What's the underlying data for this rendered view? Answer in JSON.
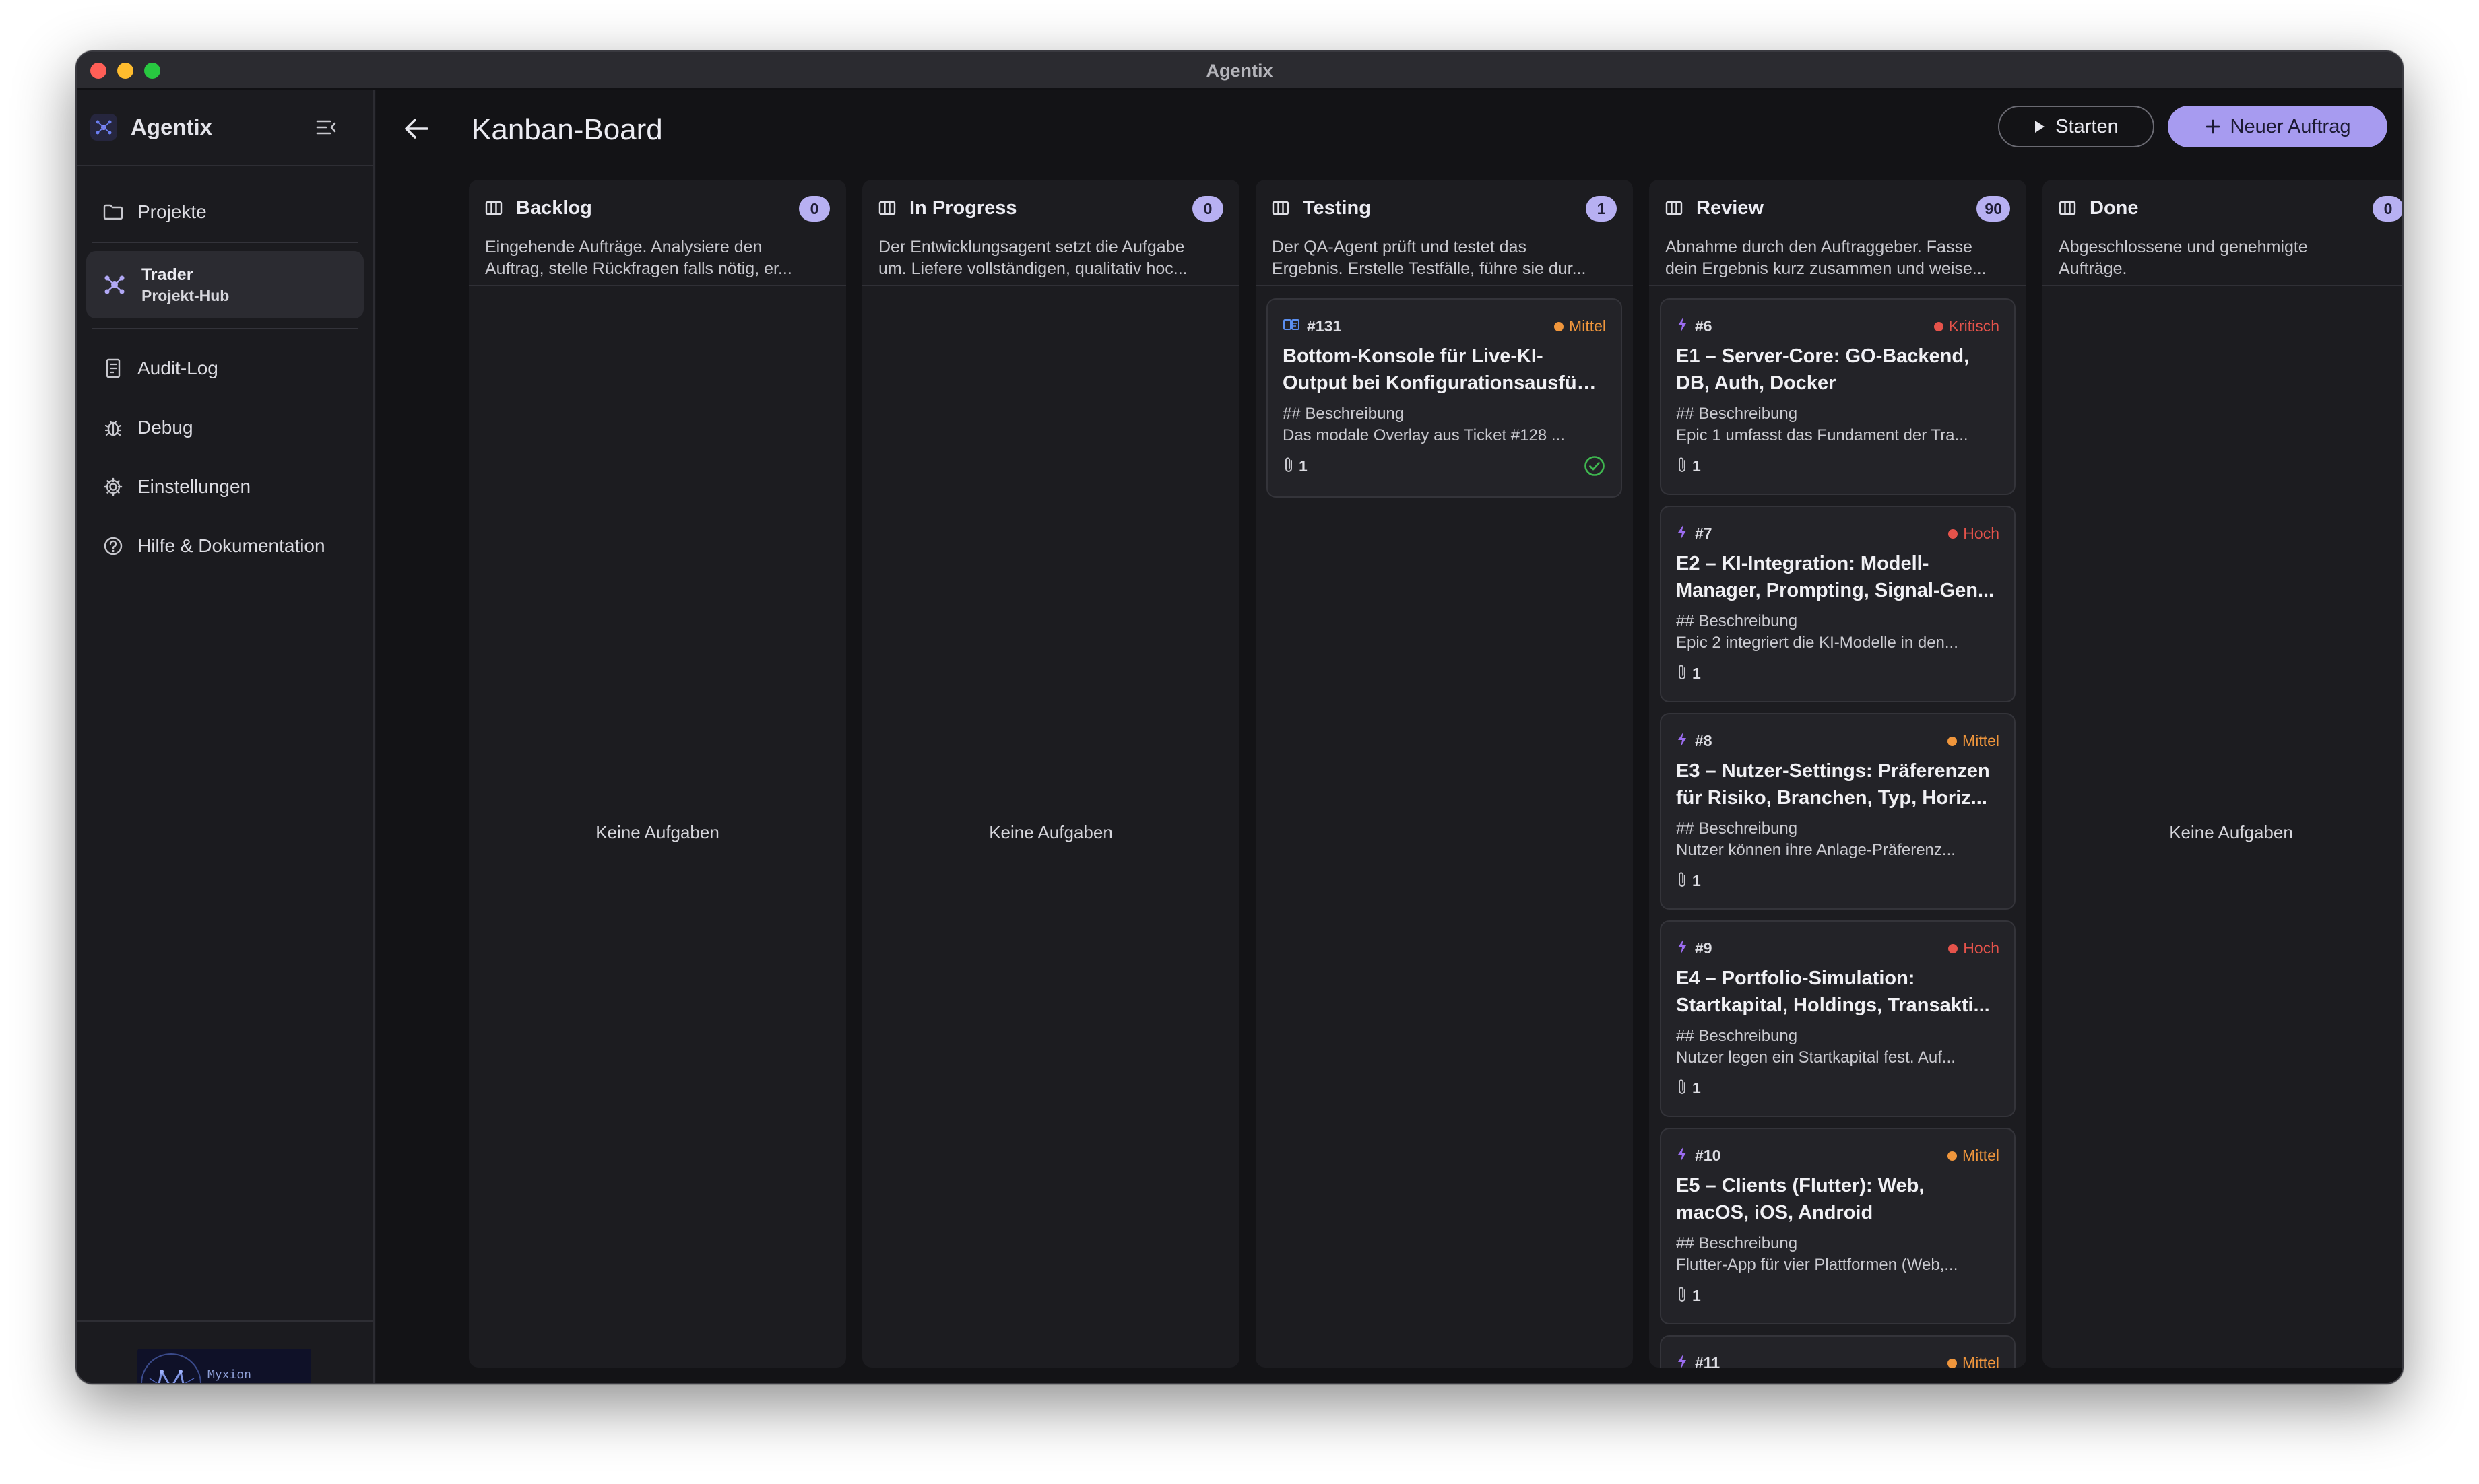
{
  "window": {
    "title": "Agentix"
  },
  "sidebar": {
    "brand": "Agentix",
    "nav_projects": "Projekte",
    "project": {
      "name": "Trader",
      "subtitle": "Projekt-Hub"
    },
    "items": [
      {
        "label": "Audit-Log",
        "icon": "document-icon"
      },
      {
        "label": "Debug",
        "icon": "bug-icon"
      },
      {
        "label": "Einstellungen",
        "icon": "gear-icon"
      },
      {
        "label": "Hilfe & Dokumentation",
        "icon": "help-icon"
      }
    ],
    "footer_logo_text": "Myxion"
  },
  "header": {
    "title": "Kanban-Board",
    "start_label": "Starten",
    "new_label": "Neuer Auftrag"
  },
  "empty_label": "Keine Aufgaben",
  "colors": {
    "accent": "#a79bf0",
    "mittel": "#f0963c",
    "hoch": "#e5534b",
    "kritisch": "#e5534b",
    "success": "#3fb950"
  },
  "columns": [
    {
      "title": "Backlog",
      "count": "0",
      "desc": [
        "Eingehende Aufträge. Analysiere den",
        "Auftrag, stelle Rückfragen falls nötig, er..."
      ]
    },
    {
      "title": "In Progress",
      "count": "0",
      "desc": [
        "Der Entwicklungsagent setzt die Aufgabe",
        "um. Liefere vollständigen, qualitativ hoc..."
      ]
    },
    {
      "title": "Testing",
      "count": "1",
      "desc": [
        "Der QA-Agent prüft und testet das",
        "Ergebnis. Erstelle Testfälle, führe sie dur..."
      ],
      "cards": [
        {
          "id": "#131",
          "priority": "Mittel",
          "title": [
            "Bottom-Konsole für Live-KI-",
            "Output bei Konfigurationsausführ..."
          ],
          "desc": [
            "## Beschreibung",
            "Das modale Overlay aus Ticket #128 ..."
          ],
          "attachments": "1"
        }
      ]
    },
    {
      "title": "Review",
      "count": "90",
      "desc": [
        "Abnahme durch den Auftraggeber. Fasse",
        "dein Ergebnis kurz zusammen und weise..."
      ],
      "cards": [
        {
          "id": "#6",
          "priority": "Kritisch",
          "title": [
            "E1 – Server-Core: GO-Backend,",
            "DB, Auth, Docker"
          ],
          "desc": [
            "## Beschreibung",
            "Epic 1 umfasst das Fundament der Tra..."
          ],
          "attachments": "1"
        },
        {
          "id": "#7",
          "priority": "Hoch",
          "title": [
            "E2 – KI-Integration: Modell-",
            "Manager, Prompting, Signal-Gen..."
          ],
          "desc": [
            "## Beschreibung",
            "Epic 2 integriert die KI-Modelle in den..."
          ],
          "attachments": "1"
        },
        {
          "id": "#8",
          "priority": "Mittel",
          "title": [
            "E3 – Nutzer-Settings: Präferenzen",
            "für Risiko, Branchen, Typ, Horiz..."
          ],
          "desc": [
            "## Beschreibung",
            "Nutzer können ihre Anlage-Präferenz..."
          ],
          "attachments": "1"
        },
        {
          "id": "#9",
          "priority": "Hoch",
          "title": [
            "E4 – Portfolio-Simulation:",
            "Startkapital, Holdings, Transakti..."
          ],
          "desc": [
            "## Beschreibung",
            "Nutzer legen ein Startkapital fest. Auf..."
          ],
          "attachments": "1"
        },
        {
          "id": "#10",
          "priority": "Mittel",
          "title": [
            "E5 – Clients (Flutter): Web,",
            "macOS, iOS, Android"
          ],
          "desc": [
            "## Beschreibung",
            "Flutter-App für vier Plattformen (Web,..."
          ],
          "attachments": "1"
        },
        {
          "id": "#11",
          "priority": "Mittel"
        }
      ]
    },
    {
      "title": "Done",
      "count": "0",
      "desc": [
        "Abgeschlossene und genehmigte",
        "Aufträge."
      ]
    }
  ]
}
